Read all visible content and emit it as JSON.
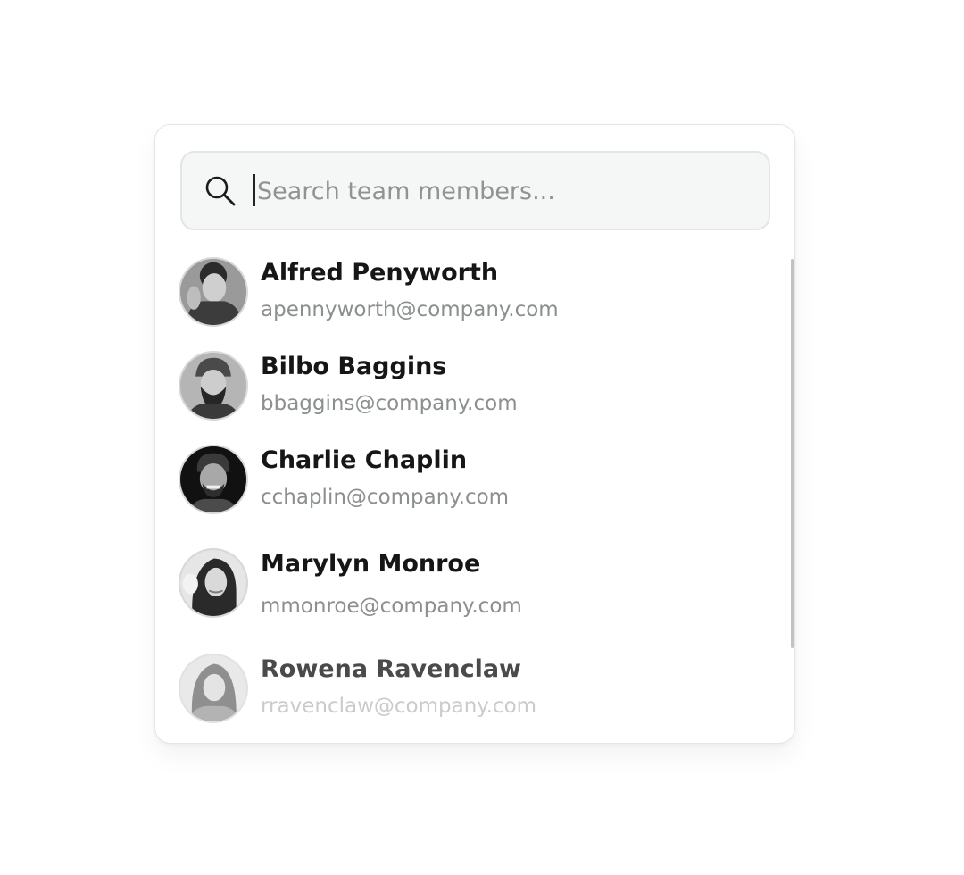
{
  "search": {
    "placeholder": "Search team members..."
  },
  "members": [
    {
      "name": "Alfred Penyworth",
      "email": "apennyworth@company.com",
      "avatar_icon": "person-avatar-photo"
    },
    {
      "name": "Bilbo Baggins",
      "email": "bbaggins@company.com",
      "avatar_icon": "person-avatar-photo"
    },
    {
      "name": "Charlie Chaplin",
      "email": "cchaplin@company.com",
      "avatar_icon": "person-avatar-photo"
    },
    {
      "name": "Marylyn Monroe",
      "email": "mmonroe@company.com",
      "avatar_icon": "person-avatar-photo"
    },
    {
      "name": "Rowena Ravenclaw",
      "email": "rravenclaw@company.com",
      "avatar_icon": "person-avatar-photo"
    }
  ],
  "colors": {
    "name_text": "#161616",
    "email_text": "#8b8f8f",
    "search_bg": "#f5f6f6"
  }
}
